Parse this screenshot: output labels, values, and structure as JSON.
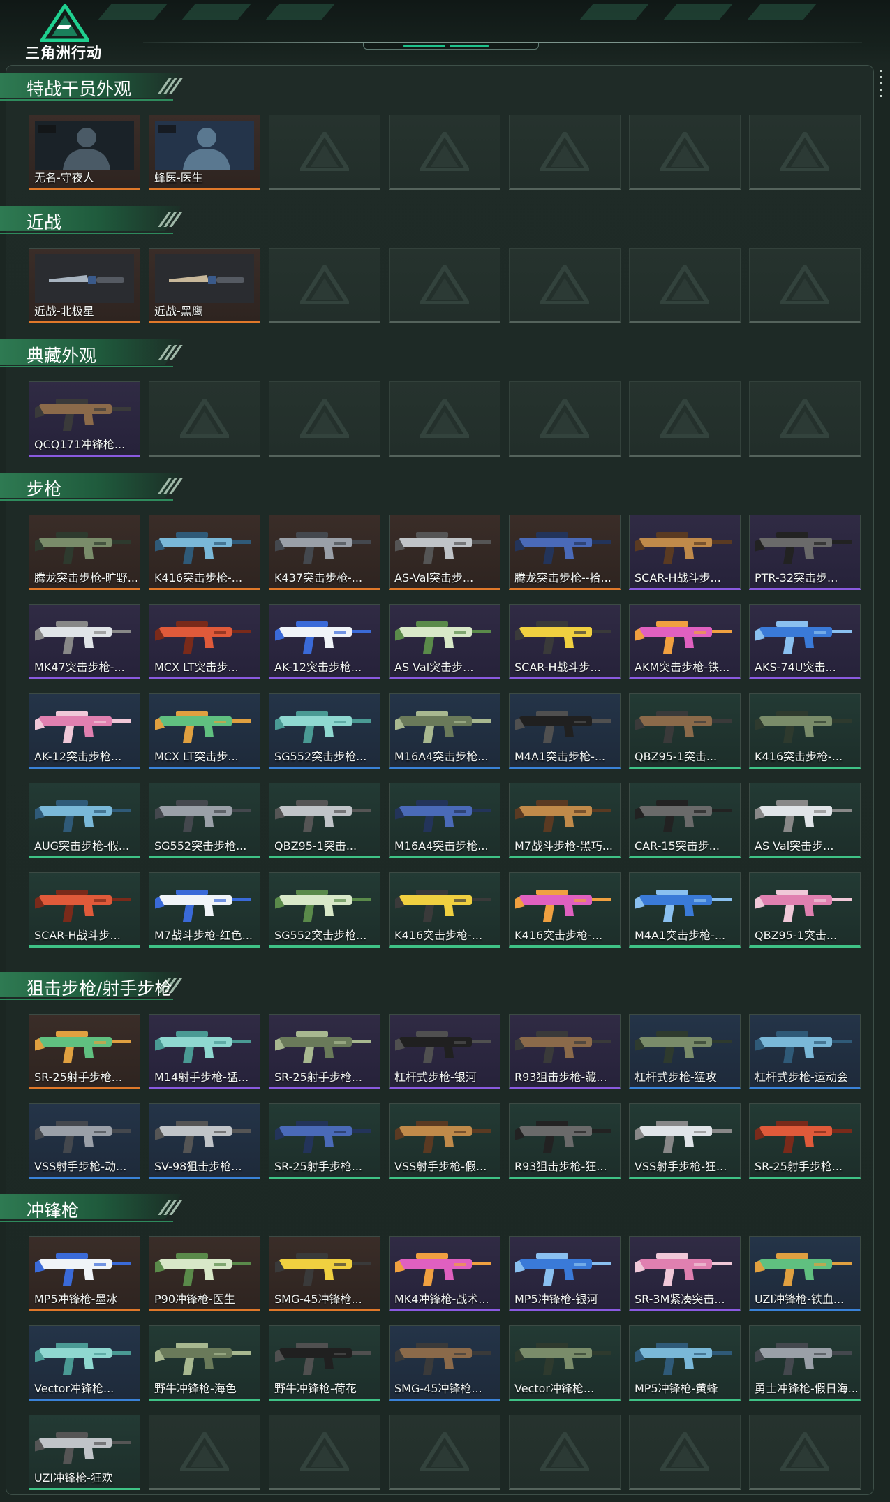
{
  "header": {
    "game_title": "三角洲行动"
  },
  "sections": [
    {
      "title": "特战干员外观",
      "items": [
        {
          "label": "无名-守夜人",
          "rarity": "orange"
        },
        {
          "label": "蜂医-医生",
          "rarity": "orange"
        }
      ],
      "empty_slots": 5
    },
    {
      "title": "近战",
      "items": [
        {
          "label": "近战-北极星",
          "rarity": "orange"
        },
        {
          "label": "近战-黑鹰",
          "rarity": "orange"
        }
      ],
      "empty_slots": 5
    },
    {
      "title": "典藏外观",
      "items": [
        {
          "label": "QCQ171冲锋枪...",
          "rarity": "purple"
        }
      ],
      "empty_slots": 6
    },
    {
      "title": "步枪",
      "items": [
        {
          "label": "腾龙突击步枪-旷野...",
          "rarity": "orange"
        },
        {
          "label": "K416突击步枪-...",
          "rarity": "orange"
        },
        {
          "label": "K437突击步枪-...",
          "rarity": "orange"
        },
        {
          "label": "AS-Val突击步...",
          "rarity": "orange"
        },
        {
          "label": "腾龙突击步枪--拾...",
          "rarity": "orange"
        },
        {
          "label": "SCAR-H战斗步...",
          "rarity": "purple"
        },
        {
          "label": "PTR-32突击步...",
          "rarity": "purple"
        },
        {
          "label": "MK47突击步枪-...",
          "rarity": "purple"
        },
        {
          "label": "MCX LT突击步...",
          "rarity": "purple"
        },
        {
          "label": "AK-12突击步枪...",
          "rarity": "purple"
        },
        {
          "label": "AS Val突击步...",
          "rarity": "purple"
        },
        {
          "label": "SCAR-H战斗步...",
          "rarity": "purple"
        },
        {
          "label": "AKM突击步枪-铁...",
          "rarity": "purple"
        },
        {
          "label": "AKS-74U突击...",
          "rarity": "purple"
        },
        {
          "label": "AK-12突击步枪...",
          "rarity": "blue"
        },
        {
          "label": "MCX LT突击步...",
          "rarity": "blue"
        },
        {
          "label": "SG552突击步枪...",
          "rarity": "blue"
        },
        {
          "label": "M16A4突击步枪...",
          "rarity": "blue"
        },
        {
          "label": "M4A1突击步枪-...",
          "rarity": "blue"
        },
        {
          "label": "QBZ95-1突击...",
          "rarity": "green"
        },
        {
          "label": "K416突击步枪-...",
          "rarity": "green"
        },
        {
          "label": "AUG突击步枪-假...",
          "rarity": "green"
        },
        {
          "label": "SG552突击步枪...",
          "rarity": "green"
        },
        {
          "label": "QBZ95-1突击...",
          "rarity": "green"
        },
        {
          "label": "M16A4突击步枪...",
          "rarity": "green"
        },
        {
          "label": "M7战斗步枪-黑巧...",
          "rarity": "green"
        },
        {
          "label": "CAR-15突击步...",
          "rarity": "green"
        },
        {
          "label": "AS Val突击步...",
          "rarity": "green"
        },
        {
          "label": "SCAR-H战斗步...",
          "rarity": "green"
        },
        {
          "label": "M7战斗步枪-红色...",
          "rarity": "green"
        },
        {
          "label": "SG552突击步枪...",
          "rarity": "green"
        },
        {
          "label": "K416突击步枪-...",
          "rarity": "green"
        },
        {
          "label": "K416突击步枪-...",
          "rarity": "green"
        },
        {
          "label": "M4A1突击步枪-...",
          "rarity": "green"
        },
        {
          "label": "QBZ95-1突击...",
          "rarity": "green"
        }
      ],
      "empty_slots": 0
    },
    {
      "title": "狙击步枪/射手步枪",
      "items": [
        {
          "label": "SR-25射手步枪...",
          "rarity": "orange"
        },
        {
          "label": "M14射手步枪-猛...",
          "rarity": "purple"
        },
        {
          "label": "SR-25射手步枪...",
          "rarity": "purple"
        },
        {
          "label": "杠杆式步枪-银河",
          "rarity": "purple"
        },
        {
          "label": "R93狙击步枪-藏...",
          "rarity": "purple"
        },
        {
          "label": "杠杆式步枪-猛攻",
          "rarity": "blue"
        },
        {
          "label": "杠杆式步枪-运动会",
          "rarity": "blue"
        },
        {
          "label": "VSS射手步枪-动...",
          "rarity": "blue"
        },
        {
          "label": "SV-98狙击步枪...",
          "rarity": "blue"
        },
        {
          "label": "SR-25射手步枪...",
          "rarity": "green"
        },
        {
          "label": "VSS射手步枪-假...",
          "rarity": "green"
        },
        {
          "label": "R93狙击步枪-狂...",
          "rarity": "green"
        },
        {
          "label": "VSS射手步枪-狂...",
          "rarity": "green"
        },
        {
          "label": "SR-25射手步枪...",
          "rarity": "green"
        }
      ],
      "empty_slots": 0
    },
    {
      "title": "冲锋枪",
      "items": [
        {
          "label": "MP5冲锋枪-墨冰",
          "rarity": "orange"
        },
        {
          "label": "P90冲锋枪-医生",
          "rarity": "orange"
        },
        {
          "label": "SMG-45冲锋枪...",
          "rarity": "orange"
        },
        {
          "label": "MK4冲锋枪-战术...",
          "rarity": "purple"
        },
        {
          "label": "MP5冲锋枪-银河",
          "rarity": "purple"
        },
        {
          "label": "SR-3M紧凑突击...",
          "rarity": "purple"
        },
        {
          "label": "UZI冲锋枪-铁血...",
          "rarity": "blue"
        },
        {
          "label": "Vector冲锋枪...",
          "rarity": "blue"
        },
        {
          "label": "野牛冲锋枪-海色",
          "rarity": "green"
        },
        {
          "label": "野牛冲锋枪-荷花",
          "rarity": "green"
        },
        {
          "label": "SMG-45冲锋枪...",
          "rarity": "blue"
        },
        {
          "label": "Vector冲锋枪...",
          "rarity": "green"
        },
        {
          "label": "MP5冲锋枪-黄蜂",
          "rarity": "green"
        },
        {
          "label": "勇士冲锋枪-假日海...",
          "rarity": "green"
        },
        {
          "label": "UZI冲锋枪-狂欢",
          "rarity": "green"
        }
      ],
      "empty_slots": 6
    }
  ],
  "colors": {
    "orange": "#e0782a",
    "purple": "#8a5ae0",
    "blue": "#3a82d8",
    "green": "#3fc286",
    "accent": "#2e8a5c"
  }
}
